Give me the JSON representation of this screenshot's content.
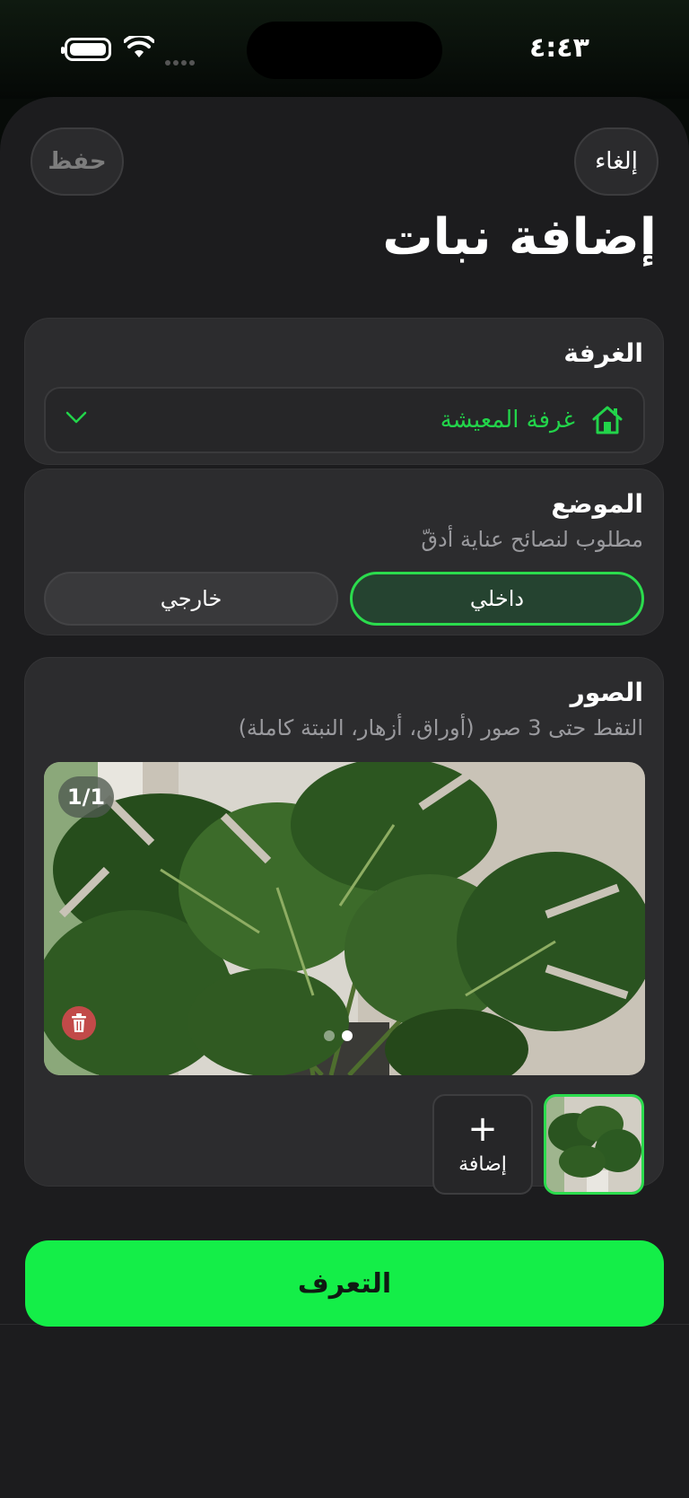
{
  "status_bar": {
    "time": "٤:٤٣"
  },
  "header": {
    "cancel_label": "إلغاء",
    "save_label": "حفظ",
    "title": "إضافة نبات"
  },
  "room": {
    "section_title": "الغرفة",
    "selected_value": "غرفة المعيشة",
    "icon": "home-icon",
    "dropdown_icon": "chevron-down-icon"
  },
  "location": {
    "section_title": "الموضع",
    "subtitle": "مطلوب لنصائح عناية أدقّ",
    "options": [
      {
        "label": "داخلي",
        "selected": true
      },
      {
        "label": "خارجي",
        "selected": false
      }
    ]
  },
  "photos": {
    "section_title": "الصور",
    "subtitle": "التقط حتى 3 صور (أوراق، أزهار، النبتة كاملة)",
    "counter": "1/1",
    "add_label": "إضافة",
    "add_icon": "+"
  },
  "primary_action": {
    "label": "التعرف"
  },
  "colors": {
    "accent": "#14ee48",
    "selected_border": "#2bdc4d",
    "card_bg": "#2c2c2e",
    "sheet_bg": "#1c1c1e",
    "delete": "#c24a49"
  }
}
